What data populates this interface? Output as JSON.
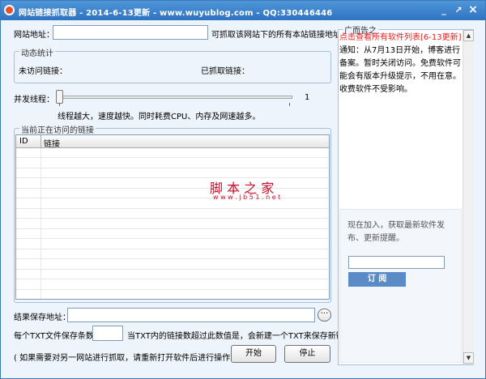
{
  "window": {
    "title": "网站链接抓取器 - 2014-6-13更新 - www.wuyublog.com - QQ:330446446",
    "minimize": "_",
    "restore": "↗",
    "close": "×"
  },
  "site": {
    "label": "网站地址：",
    "value": "",
    "hint": "可抓取该网站下的所有本站链接地址。"
  },
  "stats": {
    "title": "动态统计",
    "unvisited_label": "未访问链接：",
    "fetched_label": "已抓取链接："
  },
  "threads": {
    "label": "并发线程：",
    "value": "1",
    "max_label": "1",
    "note": "线程越大，速度越快。同时耗费CPU、内存及网速越多。",
    "level": 0
  },
  "current": {
    "title": "当前正在访问的链接",
    "columns": [
      "ID",
      "链接"
    ]
  },
  "watermark": {
    "brand": "脚 本 之 家",
    "url": "w w w . j b 5 1 . n e t"
  },
  "save": {
    "label": "结果保存地址：",
    "value": "",
    "browse": "···"
  },
  "per_file": {
    "label": "每个TXT文件保存条数：",
    "value": "",
    "note": "当TXT内的链接数超过此数值是，会新建一个TXT来保存新链接。"
  },
  "footer": {
    "note": "( 如果需要对另一网站进行抓取，请重新打开软件后进行操作！ )",
    "start": "开始",
    "stop": "停止"
  },
  "ad": {
    "title": "广而告之",
    "link": "点击查看所有软件列表[6-13更新]",
    "notice": "通知：从7月13日开始，博客进行备案。暂时关闭访问。免费软件可能会有版本升级提示，不用在意。收费软件不受影响。",
    "subscribe_text": "现在加入，获取最新软件发布、更新提醒。",
    "email": "",
    "subscribe_button": "订 阅"
  },
  "colors": {
    "titlebar": "#2f73c1",
    "link": "#e02020",
    "watermark": "#c8102e",
    "subscribe": "#5a8bc7"
  }
}
